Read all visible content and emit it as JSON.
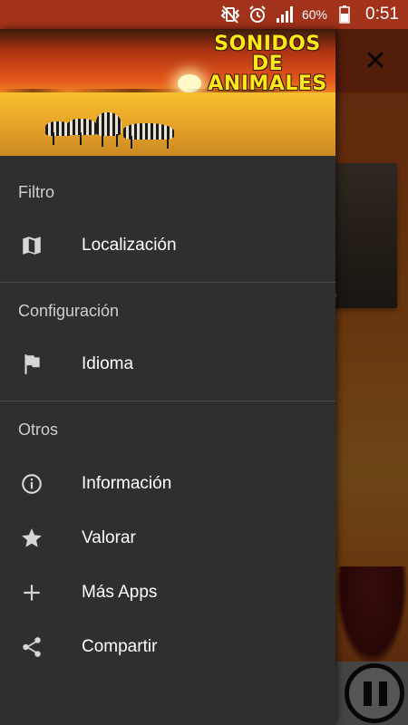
{
  "status_bar": {
    "battery_percent": "60%",
    "time": "0:51",
    "icons": [
      "mute-vibrate-icon",
      "alarm-icon",
      "signal-icon",
      "battery-icon"
    ]
  },
  "background": {
    "close_symbol": "✕",
    "card_text": "e"
  },
  "drawer": {
    "header": {
      "title_line1": "SONIDOS",
      "title_line2": "DE",
      "title_line3": "ANIMALES"
    },
    "sections": [
      {
        "title": "Filtro",
        "items": [
          {
            "label": "Localización",
            "icon": "map-icon"
          }
        ]
      },
      {
        "title": "Configuración",
        "items": [
          {
            "label": "Idioma",
            "icon": "flag-icon"
          }
        ]
      },
      {
        "title": "Otros",
        "items": [
          {
            "label": "Información",
            "icon": "info-icon"
          },
          {
            "label": "Valorar",
            "icon": "star-icon"
          },
          {
            "label": "Más Apps",
            "icon": "plus-icon"
          },
          {
            "label": "Compartir",
            "icon": "share-icon"
          }
        ]
      }
    ]
  },
  "colors": {
    "status_bar": "#a3321a",
    "drawer_bg": "#2f2f2f",
    "title_yellow": "#ffe81a"
  }
}
